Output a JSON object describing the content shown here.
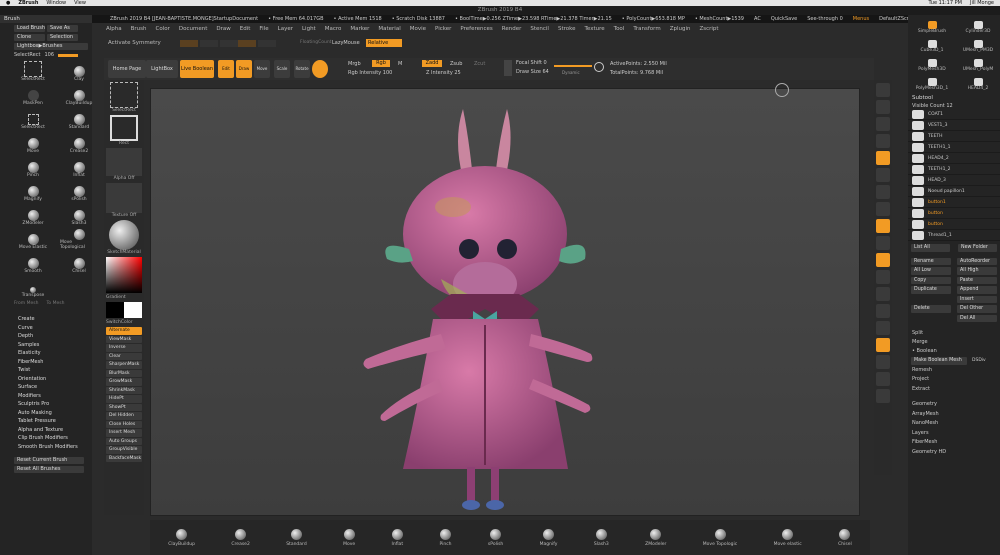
{
  "mac_menu": {
    "apple": "",
    "app": "ZBrush",
    "items": [
      "Window",
      "View"
    ],
    "clock": "Tue 11:17 PM",
    "user": "Jill Monge"
  },
  "window_title": "ZBrush 2019 B4",
  "status": {
    "doc": "ZBrush 2019 B4 [JEAN-BAPTISTE.MONGE]StartupDocument",
    "free_mem": "• Free Mem 64.017GB",
    "active_mem": "• Active Mem 1518",
    "scratch": "• Scratch Disk 13887",
    "timers": "• BoolTime▶0.256 ZTime▶23.598 RTime▶21.378 Timer▶21.15",
    "poly": "• PolyCount▶653.818 MP",
    "mesh": "• MeshCount▶1539",
    "ac": "AC",
    "quicksave": "QuickSave",
    "seethrough": "See-through 0",
    "menus": "Menus",
    "default_script": "DefaultZScript"
  },
  "menubar": [
    "Alpha",
    "Brush",
    "Color",
    "Document",
    "Draw",
    "Edit",
    "File",
    "Layer",
    "Light",
    "Macro",
    "Marker",
    "Material",
    "Movie",
    "Picker",
    "Preferences",
    "Render",
    "Stencil",
    "Stroke",
    "Texture",
    "Tool",
    "Transform",
    "Zplugin",
    "Zscript"
  ],
  "top_controls": {
    "activate_symmetry": "Activate Symmetry",
    "lazymouse": "LazyMouse",
    "relative": "Relative",
    "floating": "FloatingCount"
  },
  "left": {
    "header": "Brush",
    "load": "Load Brush",
    "save": "Save As",
    "clone": "Clone",
    "selection": "Selection",
    "lightbox": "Lightbox▶Brushes",
    "select_rect": "SelectRect",
    "select_value": "106",
    "brushes": [
      "SelectRect",
      "Clay",
      "MaskPen",
      "ClayBuildup",
      "SelectRect",
      "Standard",
      "Move",
      "Crease2",
      "Pinch",
      "Inflat",
      "Magnify",
      "sPolish",
      "ZModeler",
      "Slash3",
      "Move Elastic",
      "Move Topological",
      "Smooth",
      "Chisel",
      "Transpose"
    ],
    "from_mesh": "From Mesh",
    "to_mesh": "To Mesh",
    "sections": [
      "Create",
      "Curve",
      "Depth",
      "Samples",
      "Elasticity",
      "FiberMesh",
      "Twist",
      "Orientation",
      "Surface",
      "Modifiers",
      "Sculptris Pro",
      "Auto Masking",
      "Tablet Pressure",
      "Alpha and Texture",
      "Clip Brush Modifiers",
      "Smooth Brush Modifiers"
    ],
    "reset_current": "Reset Current Brush",
    "reset_all": "Reset All Brushes"
  },
  "toolbar": {
    "home": "Home Page",
    "lightbox": "LightBox",
    "live_boolean": "Live Boolean",
    "edit": "Edit",
    "draw": "Draw",
    "move": "Move",
    "scale": "Scale",
    "rotate": "Rotate",
    "mrgb": "Mrgb",
    "rgb": "Rgb",
    "m": "M",
    "rgb_intensity": "Rgb Intensity 100",
    "zadd": "Zadd",
    "zsub": "Zsub",
    "zcut": "Zcut",
    "z_intensity": "Z Intensity 25",
    "focal": "Focal Shift 0",
    "draw_size": "Draw Size 64",
    "dynamic": "Dynamic",
    "active_points": "ActivePoints: 2.550 Mil",
    "total_points": "TotalPoints: 9.768 Mil"
  },
  "toolstrip": {
    "select_rect": "SelectRect",
    "rect": "Rect",
    "alpha_off": "Alpha Off",
    "texture_off": "Texture Off",
    "material": "SketchMaterial",
    "gradient": "Gradient",
    "switch_color": "SwitchColor",
    "alternate": "Alternate",
    "items": [
      "ViewMask",
      "Inverse",
      "Clear",
      "SharpenMask",
      "BlurMask",
      "GrowMask",
      "ShrinkMask",
      "HidePt",
      "ShowPt",
      "Del Hidden",
      "Close Holes",
      "Insert Mesh",
      "Auto Groups",
      "GroupVisible",
      "BackfaceMask"
    ]
  },
  "rightstrip": [
    "SPix 3",
    "Scroll",
    "Zoom",
    "Actual",
    "AAHalf",
    "Persp",
    "Floor",
    "Local",
    "L.Sym",
    "Xyz",
    "Frame",
    "Move",
    "Zoom3D",
    "Rotate",
    "Line Fill",
    "Transp",
    "Dynamic",
    "Solo",
    "Xpose"
  ],
  "right": {
    "tools": [
      "SimpleBrush",
      "Cylinder3D",
      "Cube3D_1",
      "UMesh_PM3D",
      "PolyMesh3D",
      "UMesh_PolyM",
      "PolyMesh3D_1",
      "HEAD4_2"
    ],
    "subtool": "Subtool",
    "visible_count": "Visible Count 12",
    "subtools": [
      "COAT1",
      "VEST1_3",
      "TEETH",
      "TEETH1_1",
      "HEAD4_2",
      "TEETH1_2",
      "HEAD_3",
      "Noeud papillon1",
      "button1",
      "button",
      "button",
      "Thread1_1"
    ],
    "list_all": "List All",
    "new_folder": "New Folder",
    "rename": "Rename",
    "autoreorder": "AutoReorder",
    "all_low": "All Low",
    "all_high": "All High",
    "copy": "Copy",
    "paste": "Paste",
    "duplicate": "Duplicate",
    "append": "Append",
    "insert": "Insert",
    "delete": "Delete",
    "del_other": "Del Other",
    "del_all": "Del All",
    "split": "Split",
    "merge": "Merge",
    "boolean": "• Boolean",
    "make_boolean": "Make Boolean Mesh",
    "dsdiv": "DSDiv",
    "remesh": "Remesh",
    "project": "Project",
    "extract": "Extract",
    "more": [
      "Geometry",
      "ArrayMesh",
      "NanoMesh",
      "Layers",
      "FiberMesh",
      "Geometry HD"
    ]
  },
  "shelf": [
    "ClayBuildup",
    "Crease2",
    "Standard",
    "Move",
    "Inflat",
    "Pinch",
    "sPolish",
    "Magnify",
    "Slash3",
    "ZModeler",
    "Move Topologic",
    "Move elastic",
    "Chisel"
  ]
}
